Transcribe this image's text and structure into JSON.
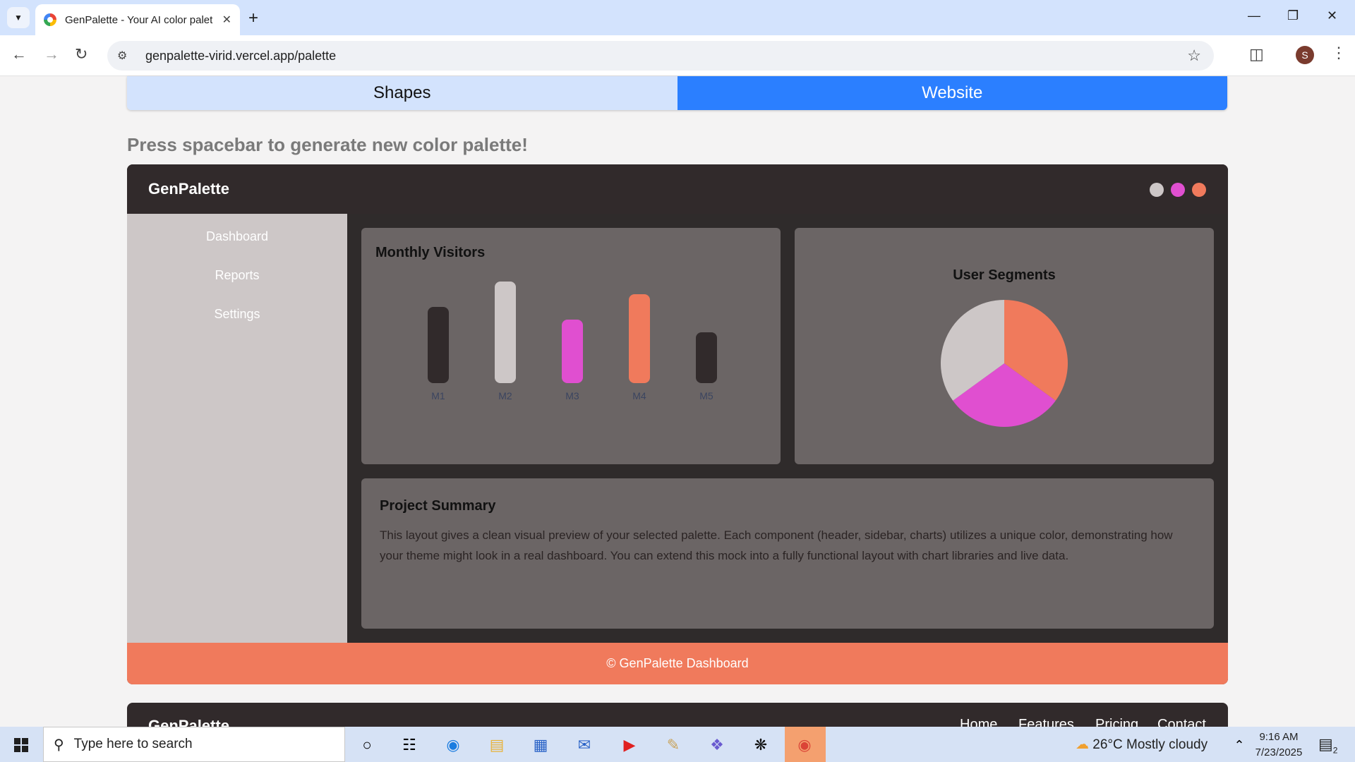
{
  "browser": {
    "tab_title": "GenPalette - Your AI color palet",
    "url": "genpalette-virid.vercel.app/palette",
    "profile_initial": "S"
  },
  "page": {
    "mode_tabs": [
      {
        "label": "Shapes",
        "active": false
      },
      {
        "label": "Website",
        "active": true
      }
    ],
    "hint": "Press spacebar to generate new color palette!"
  },
  "preview": {
    "brand": "GenPalette",
    "palette_dots": [
      "#cdc7c7",
      "#e04fd0",
      "#f07a5c"
    ],
    "sidebar": [
      "Dashboard",
      "Reports",
      "Settings"
    ],
    "monthly_visitors": {
      "title": "Monthly Visitors",
      "bars": [
        {
          "label": "M1",
          "value": 60,
          "color": "#312a2b"
        },
        {
          "label": "M2",
          "value": 80,
          "color": "#cdc7c7"
        },
        {
          "label": "M3",
          "value": 50,
          "color": "#e04fd0"
        },
        {
          "label": "M4",
          "value": 70,
          "color": "#f07a5c"
        },
        {
          "label": "M5",
          "value": 40,
          "color": "#312a2b"
        }
      ]
    },
    "user_segments": {
      "title": "User Segments",
      "slices": [
        {
          "value": 35,
          "color": "#f07a5c"
        },
        {
          "value": 30,
          "color": "#e04fd0"
        },
        {
          "value": 35,
          "color": "#cdc7c7"
        }
      ]
    },
    "summary": {
      "title": "Project Summary",
      "text": "This layout gives a clean visual preview of your selected palette. Each component (header, sidebar, charts) utilizes a unique color, demonstrating how your theme might look in a real dashboard. You can extend this mock into a fully functional layout with chart libraries and live data."
    },
    "footer": "© GenPalette Dashboard"
  },
  "next_section": {
    "brand": "GenPalette",
    "links": [
      "Home",
      "Features",
      "Pricing",
      "Contact"
    ]
  },
  "taskbar": {
    "search_placeholder": "Type here to search",
    "weather": "26°C  Mostly cloudy",
    "time": "9:16 AM",
    "date": "7/23/2025",
    "notification_count": "2"
  },
  "chart_data": [
    {
      "type": "bar",
      "title": "Monthly Visitors",
      "categories": [
        "M1",
        "M2",
        "M3",
        "M4",
        "M5"
      ],
      "values": [
        60,
        80,
        50,
        70,
        40
      ]
    },
    {
      "type": "pie",
      "title": "User Segments",
      "values": [
        35,
        30,
        35
      ]
    }
  ]
}
